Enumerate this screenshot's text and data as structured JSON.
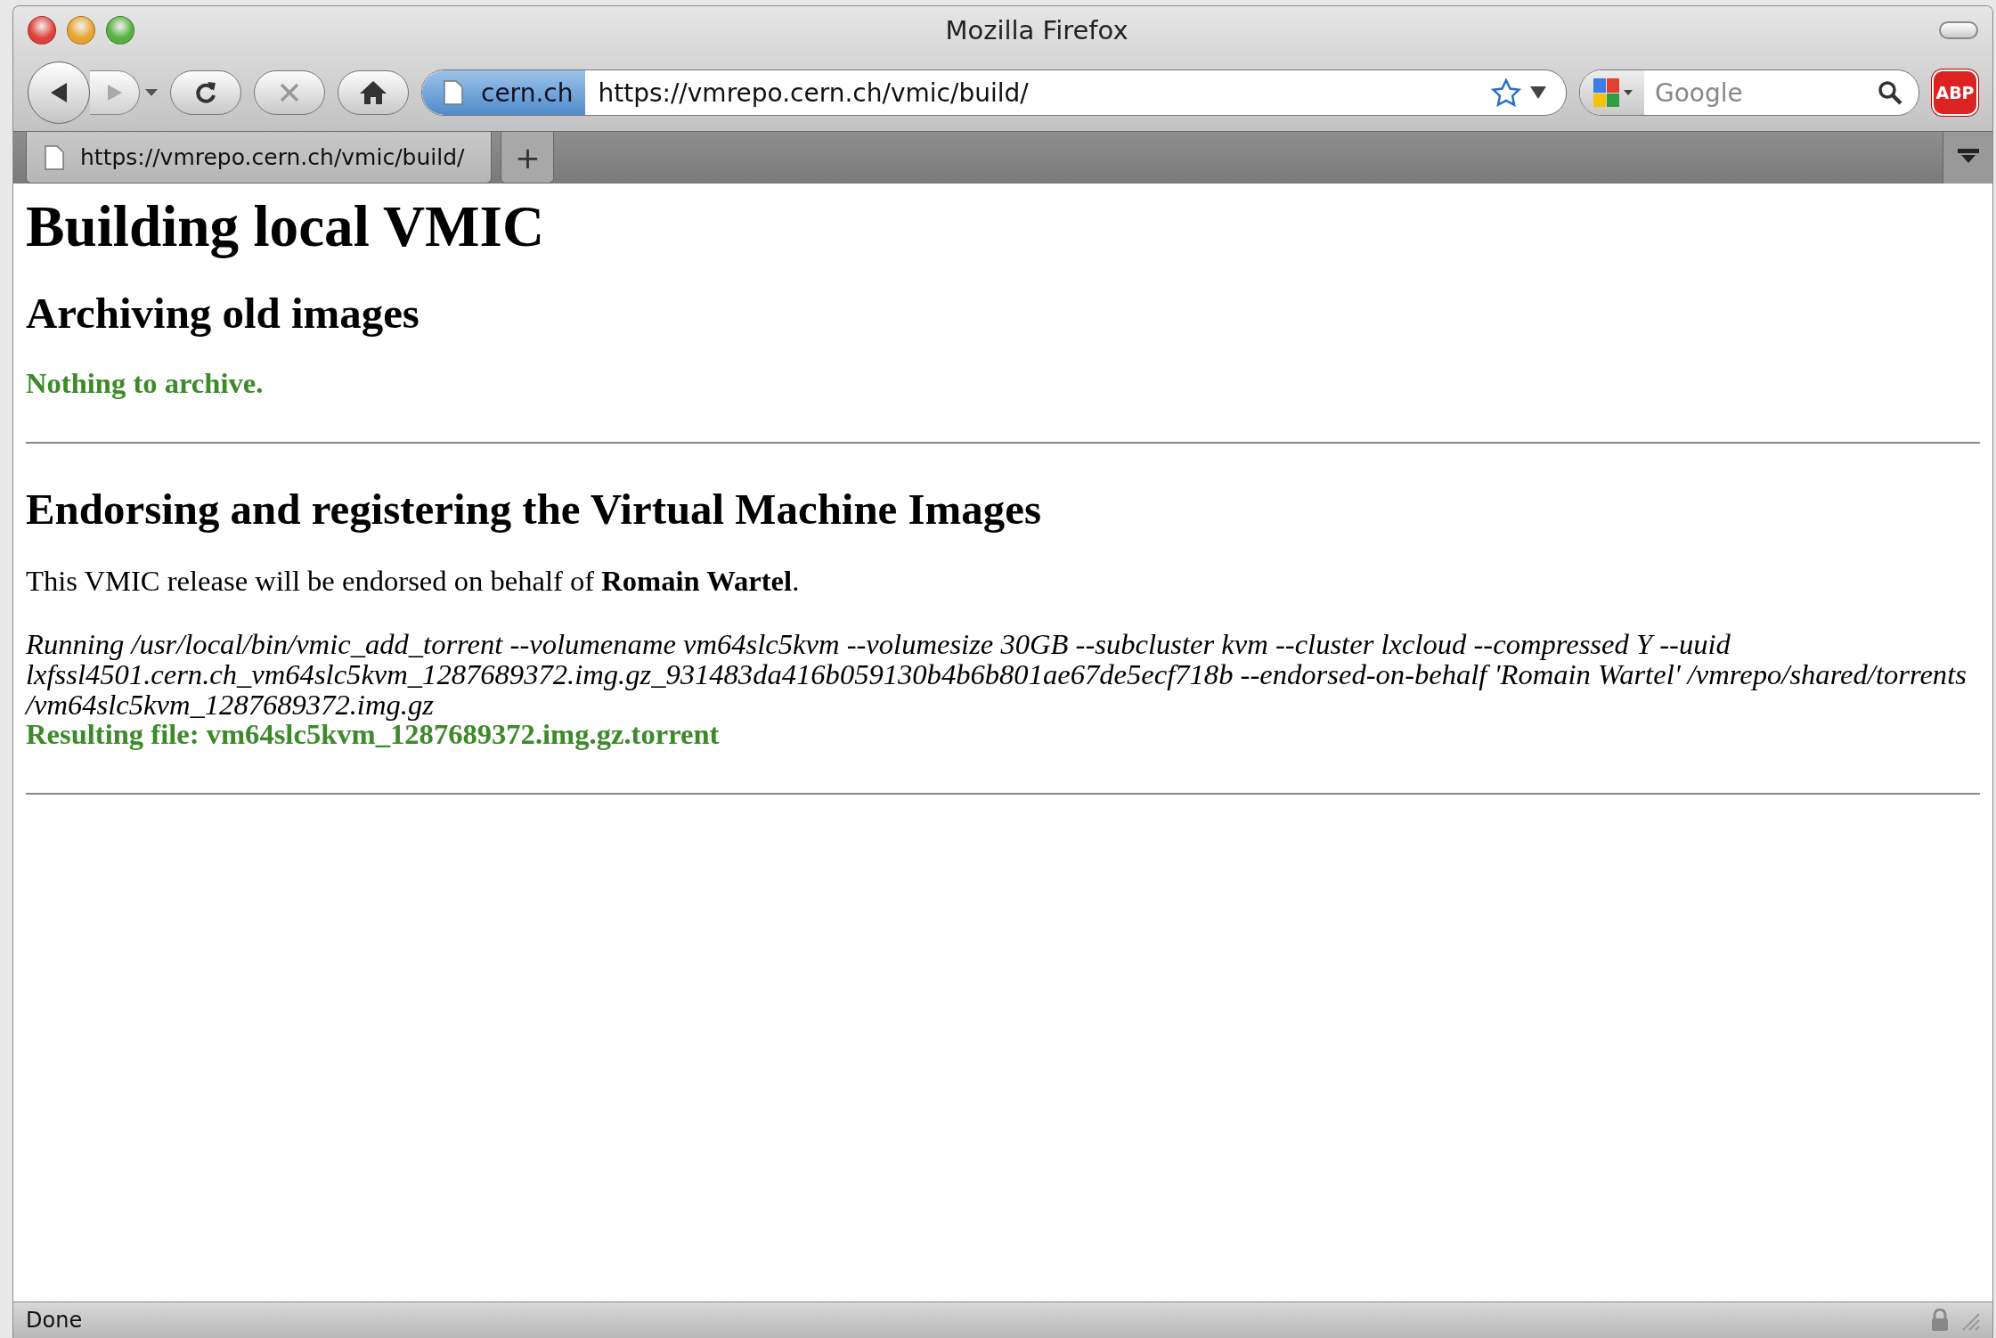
{
  "window": {
    "title": "Mozilla Firefox"
  },
  "toolbar": {
    "identity": "cern.ch",
    "url": "https://vmrepo.cern.ch/vmic/build/",
    "search": {
      "placeholder": "Google"
    },
    "addon_badge": "ABP"
  },
  "tabs": [
    {
      "label": "https://vmrepo.cern.ch/vmic/build/",
      "selected": true
    }
  ],
  "new_tab": "+",
  "page": {
    "blocks": [
      {
        "kind": "h1",
        "text": "Building local VMIC"
      },
      {
        "kind": "h2",
        "text": "Archiving old images"
      },
      {
        "kind": "success",
        "text": "Nothing to archive."
      },
      {
        "kind": "rule"
      },
      {
        "kind": "h2",
        "text": "Endorsing and registering the Virtual Machine Images"
      },
      {
        "kind": "para",
        "text": "This VMIC release will be endorsed on behalf of **Romain Wartel**."
      },
      {
        "kind": "command",
        "text": "Running /usr/local/bin/vmic_add_torrent --volumename vm64slc5kvm --volumesize 30GB --subcluster kvm --cluster lxcloud --compressed Y --uuid lxfssl4501.cern.ch_vm64slc5kvm_1287689372.img.gz_931483da416b059130b4b6b801ae67de5ecf718b --endorsed-on-behalf 'Romain Wartel' /vmrepo/shared/torrents /vm64slc5kvm_1287689372.img.gz",
        "result": "Resulting file: vm64slc5kvm_1287689372.img.gz.torrent"
      },
      {
        "kind": "rule"
      }
    ]
  },
  "status_bar": {
    "text": "Done"
  }
}
